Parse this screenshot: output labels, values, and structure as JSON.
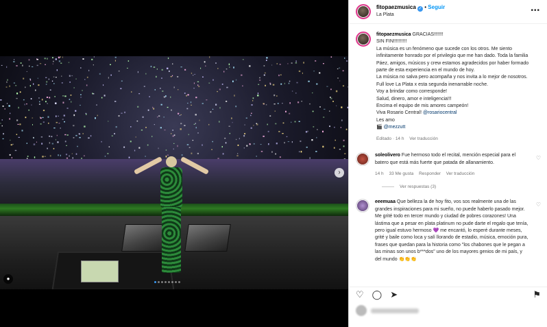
{
  "post": {
    "user": "fitopaezmusica",
    "follow_label": "Seguir",
    "location": "La Plata",
    "more_icon": "more-horizontal-icon"
  },
  "caption": {
    "user": "fitopaezmusica",
    "lines": [
      "GRACIAS!!!!!!!",
      "SIN FIN!!!!!!!!!!",
      "La música es un fenómeno que sucede con los otros. Me siento infinitamente honrado por el privilegio que me han dado. Toda la familia Páez, amigos, músicos y crew estamos agradecidos por haber formado parte de esta experiencia en el mundo de hoy.",
      "La música no salva pero acompaña y nos invita a lo mejor de nosotros.",
      "Full love La Plata x esta segunda inenarrable noche.",
      "Voy a brindar como corresponde!",
      "Salud, dinero, amor e inteligencia!!!",
      "Encima el equipo de mis amores campeón!",
      "Viva Rosario Central!"
    ],
    "mention_rosario": "@rosariocentral",
    "les_amo": "Les amo",
    "camera_icon": "🎬",
    "mention_photo": "@mezzutt",
    "edited": "Editado · 14 h",
    "translate": "Ver traducción"
  },
  "comments": [
    {
      "user": "soleolivero",
      "text": "Fue hermoso todo el recital, mención especial para el batero que está más fuerte que patada de allanamiento.",
      "time": "14 h",
      "likes": "33 Me gusta",
      "reply": "Responder",
      "translate": "Ver traducción",
      "view_replies": "Ver respuestas (3)"
    },
    {
      "user": "eeemuaa",
      "text": "Que belleza la de hoy fito, vos sos realmente una de las grandes inspiraciones para mi sueño, no puede haberlo pasado mejor. Me grité todo en tercer mundo y ciudad de pobres corazones! Una lástima que a pesar en plata platinum no pude darte el regalo que tenía, pero igual estuvo hermoso 💜 me encantó, lo esperé durante meses, grité y baile como loca y salí llorando de estadio, música, emoción pura, frases que quedan para la historia como \"los chabones que le pegan a las minas son unos b***dos\" uno de los mayores genios de mi país, y del mundo 👏👏👏"
    }
  ],
  "media": {
    "dots": 8,
    "active_dot": 0
  }
}
